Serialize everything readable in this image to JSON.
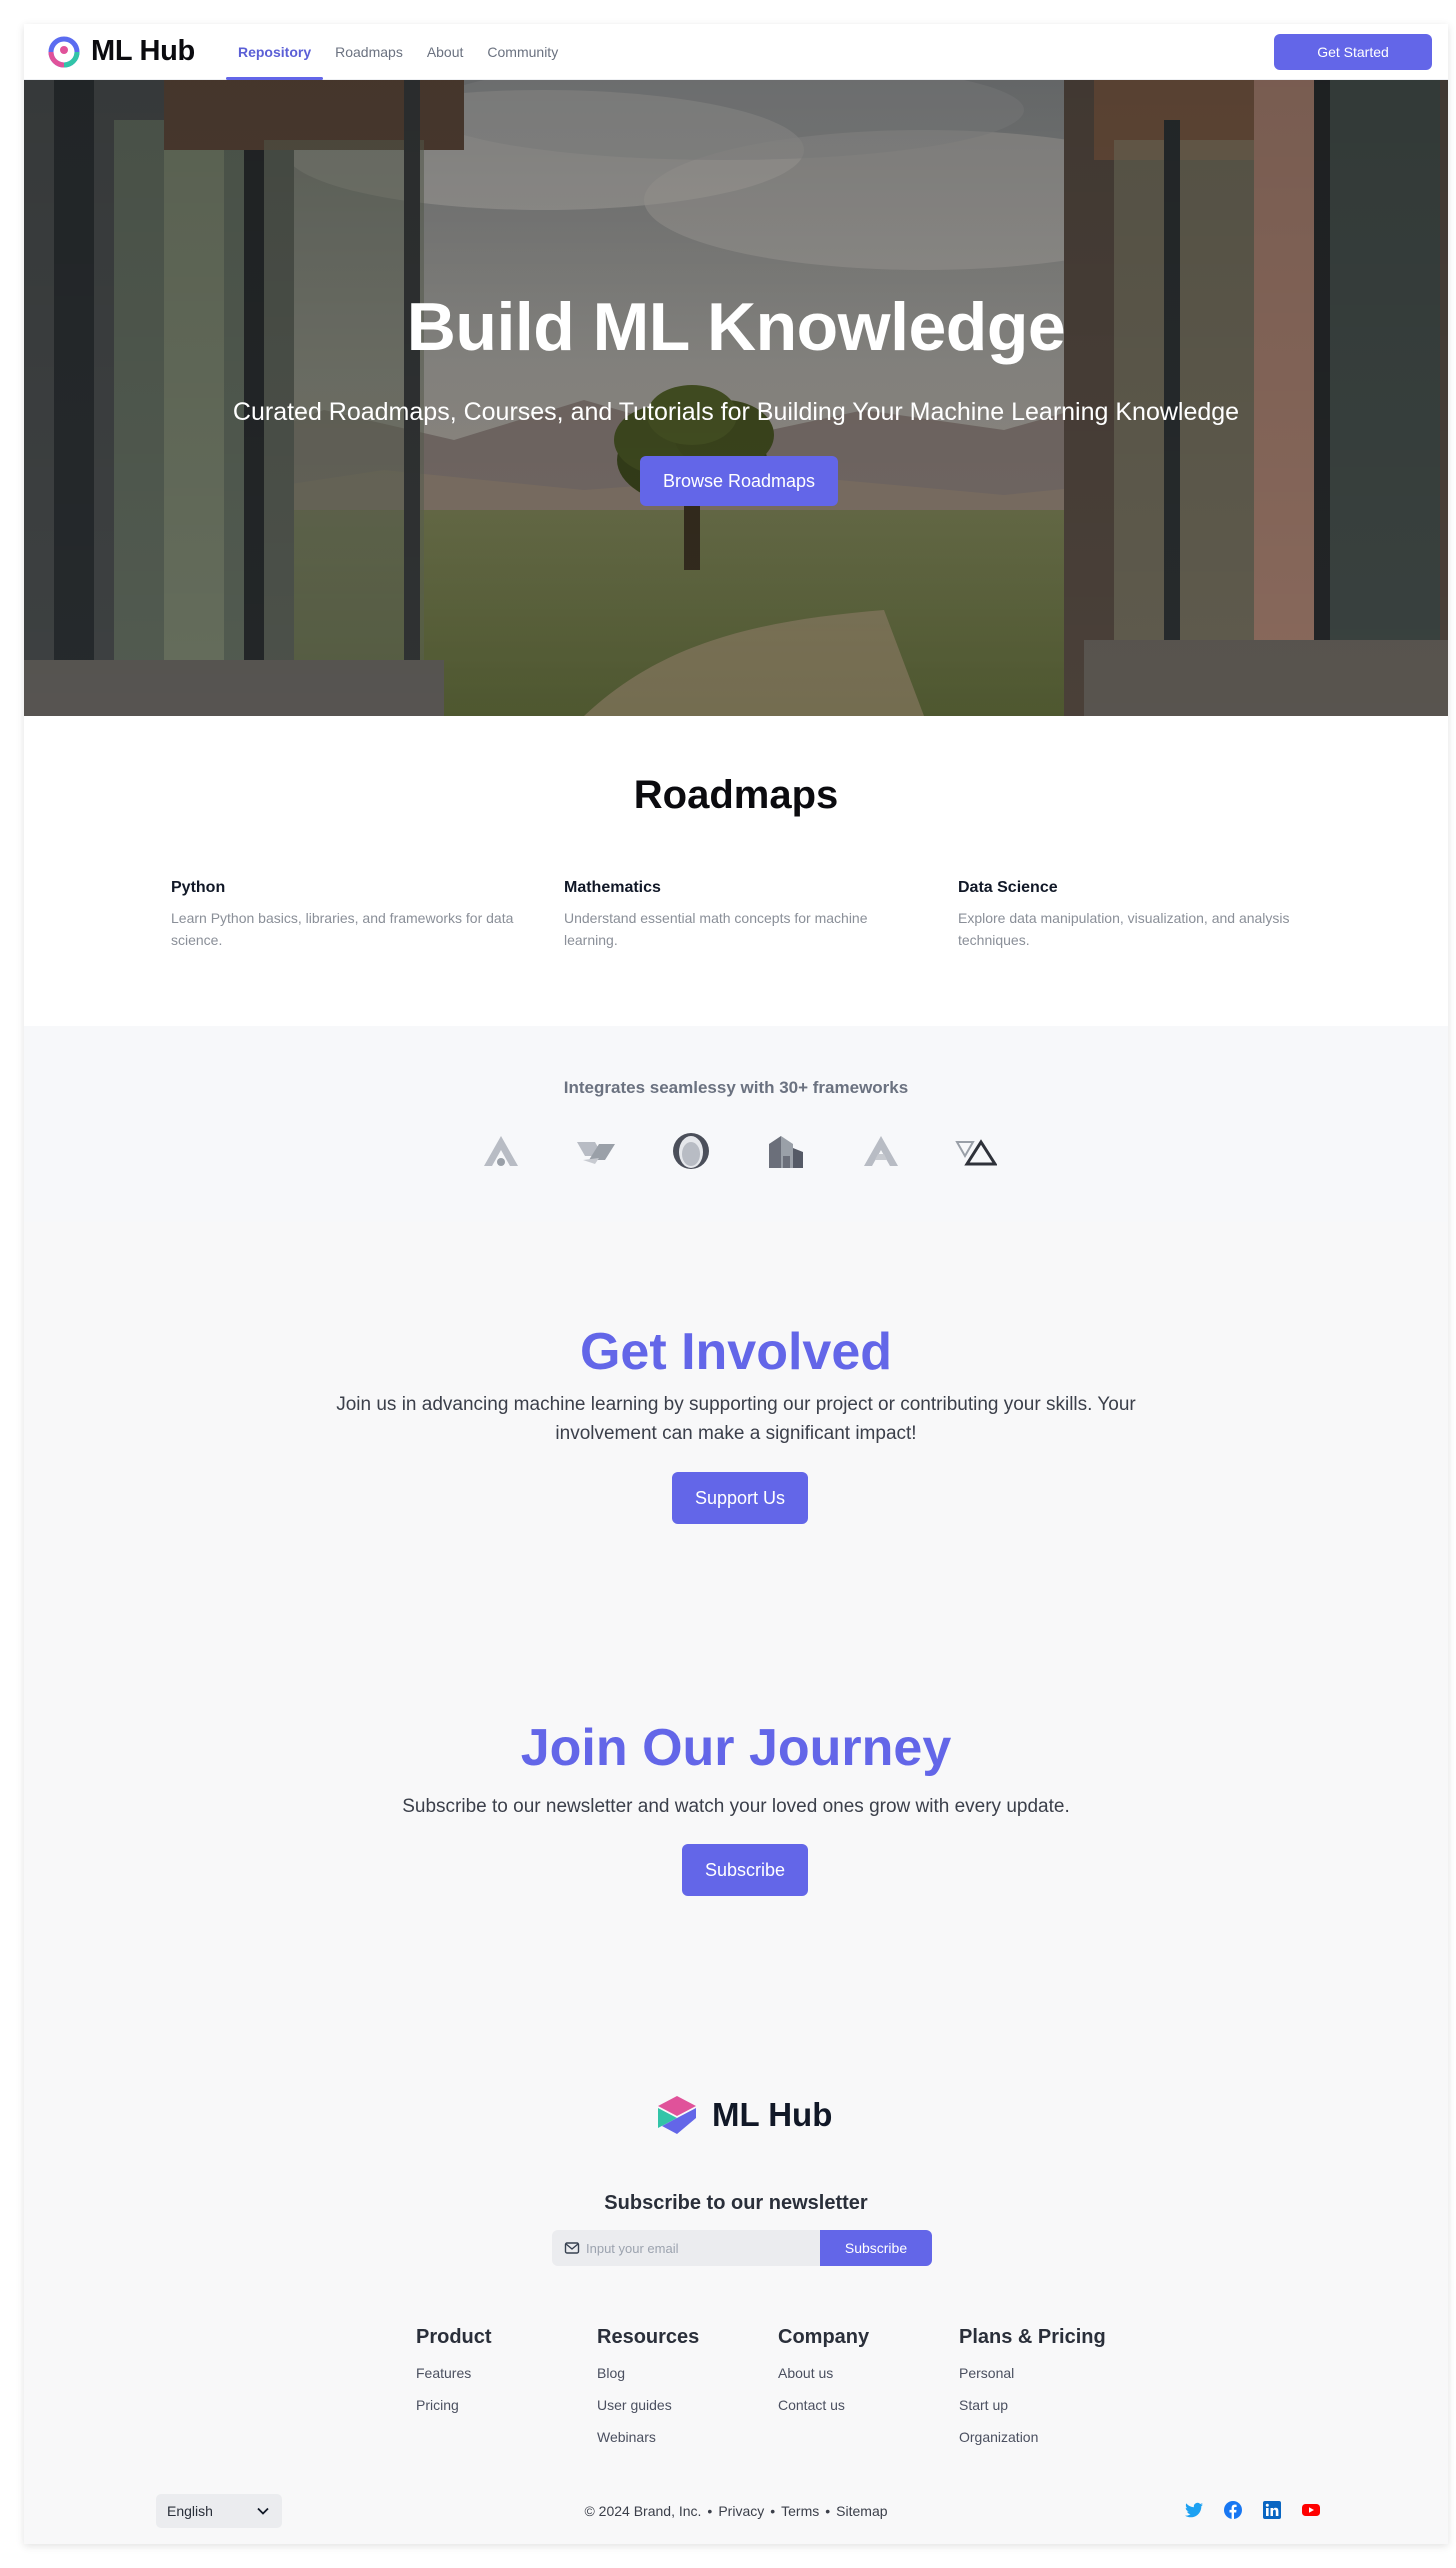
{
  "nav": {
    "brand": "ML Hub",
    "links": [
      "Repository",
      "Roadmaps",
      "About",
      "Community"
    ],
    "cta": "Get Started"
  },
  "hero": {
    "title": "Build ML Knowledge",
    "subtitle": "Curated Roadmaps, Courses, and Tutorials for Building Your Machine Learning Knowledge",
    "button": "Browse Roadmaps"
  },
  "roadmaps": {
    "title": "Roadmaps",
    "cards": [
      {
        "title": "Python",
        "desc": "Learn Python basics, libraries, and frameworks for data science."
      },
      {
        "title": "Mathematics",
        "desc": "Understand essential math concepts for machine learning."
      },
      {
        "title": "Data Science",
        "desc": "Explore data manipulation, visualization, and analysis techniques."
      }
    ]
  },
  "frameworks": {
    "title": "Integrates seamlessy with 30+ frameworks",
    "logos": [
      "framework-logo-a-icon",
      "framework-logo-stripes-icon",
      "framework-logo-ring-icon",
      "framework-logo-buildings-icon",
      "framework-logo-a-icon",
      "framework-logo-triangles-icon"
    ]
  },
  "get_involved": {
    "title": "Get Involved",
    "text": "Join us in advancing machine learning by supporting our project or contributing your skills. Your involvement can make a significant impact!",
    "button": "Support Us"
  },
  "journey": {
    "title": "Join Our Journey",
    "text": "Subscribe to our newsletter and watch your loved ones grow with every update.",
    "button": "Subscribe"
  },
  "footer": {
    "brand": "ML Hub",
    "newsletter_title": "Subscribe to our newsletter",
    "email_placeholder": "Input your email",
    "subscribe": "Subscribe",
    "columns": [
      {
        "title": "Product",
        "items": [
          "Features",
          "Pricing"
        ]
      },
      {
        "title": "Resources",
        "items": [
          "Blog",
          "User guides",
          "Webinars"
        ]
      },
      {
        "title": "Company",
        "items": [
          "About us",
          "Contact us"
        ]
      },
      {
        "title": "Plans & Pricing",
        "items": [
          "Personal",
          "Start up",
          "Organization"
        ]
      }
    ],
    "language": "English",
    "copyright": "© 2024 Brand, Inc.",
    "legal_links": [
      "Privacy",
      "Terms",
      "Sitemap"
    ],
    "social": [
      "twitter-icon",
      "facebook-icon",
      "linkedin-icon",
      "youtube-icon"
    ]
  },
  "colors": {
    "accent": "#6366e8",
    "gray_bg": "#f8f8f9",
    "text_muted": "#8a8f98"
  }
}
